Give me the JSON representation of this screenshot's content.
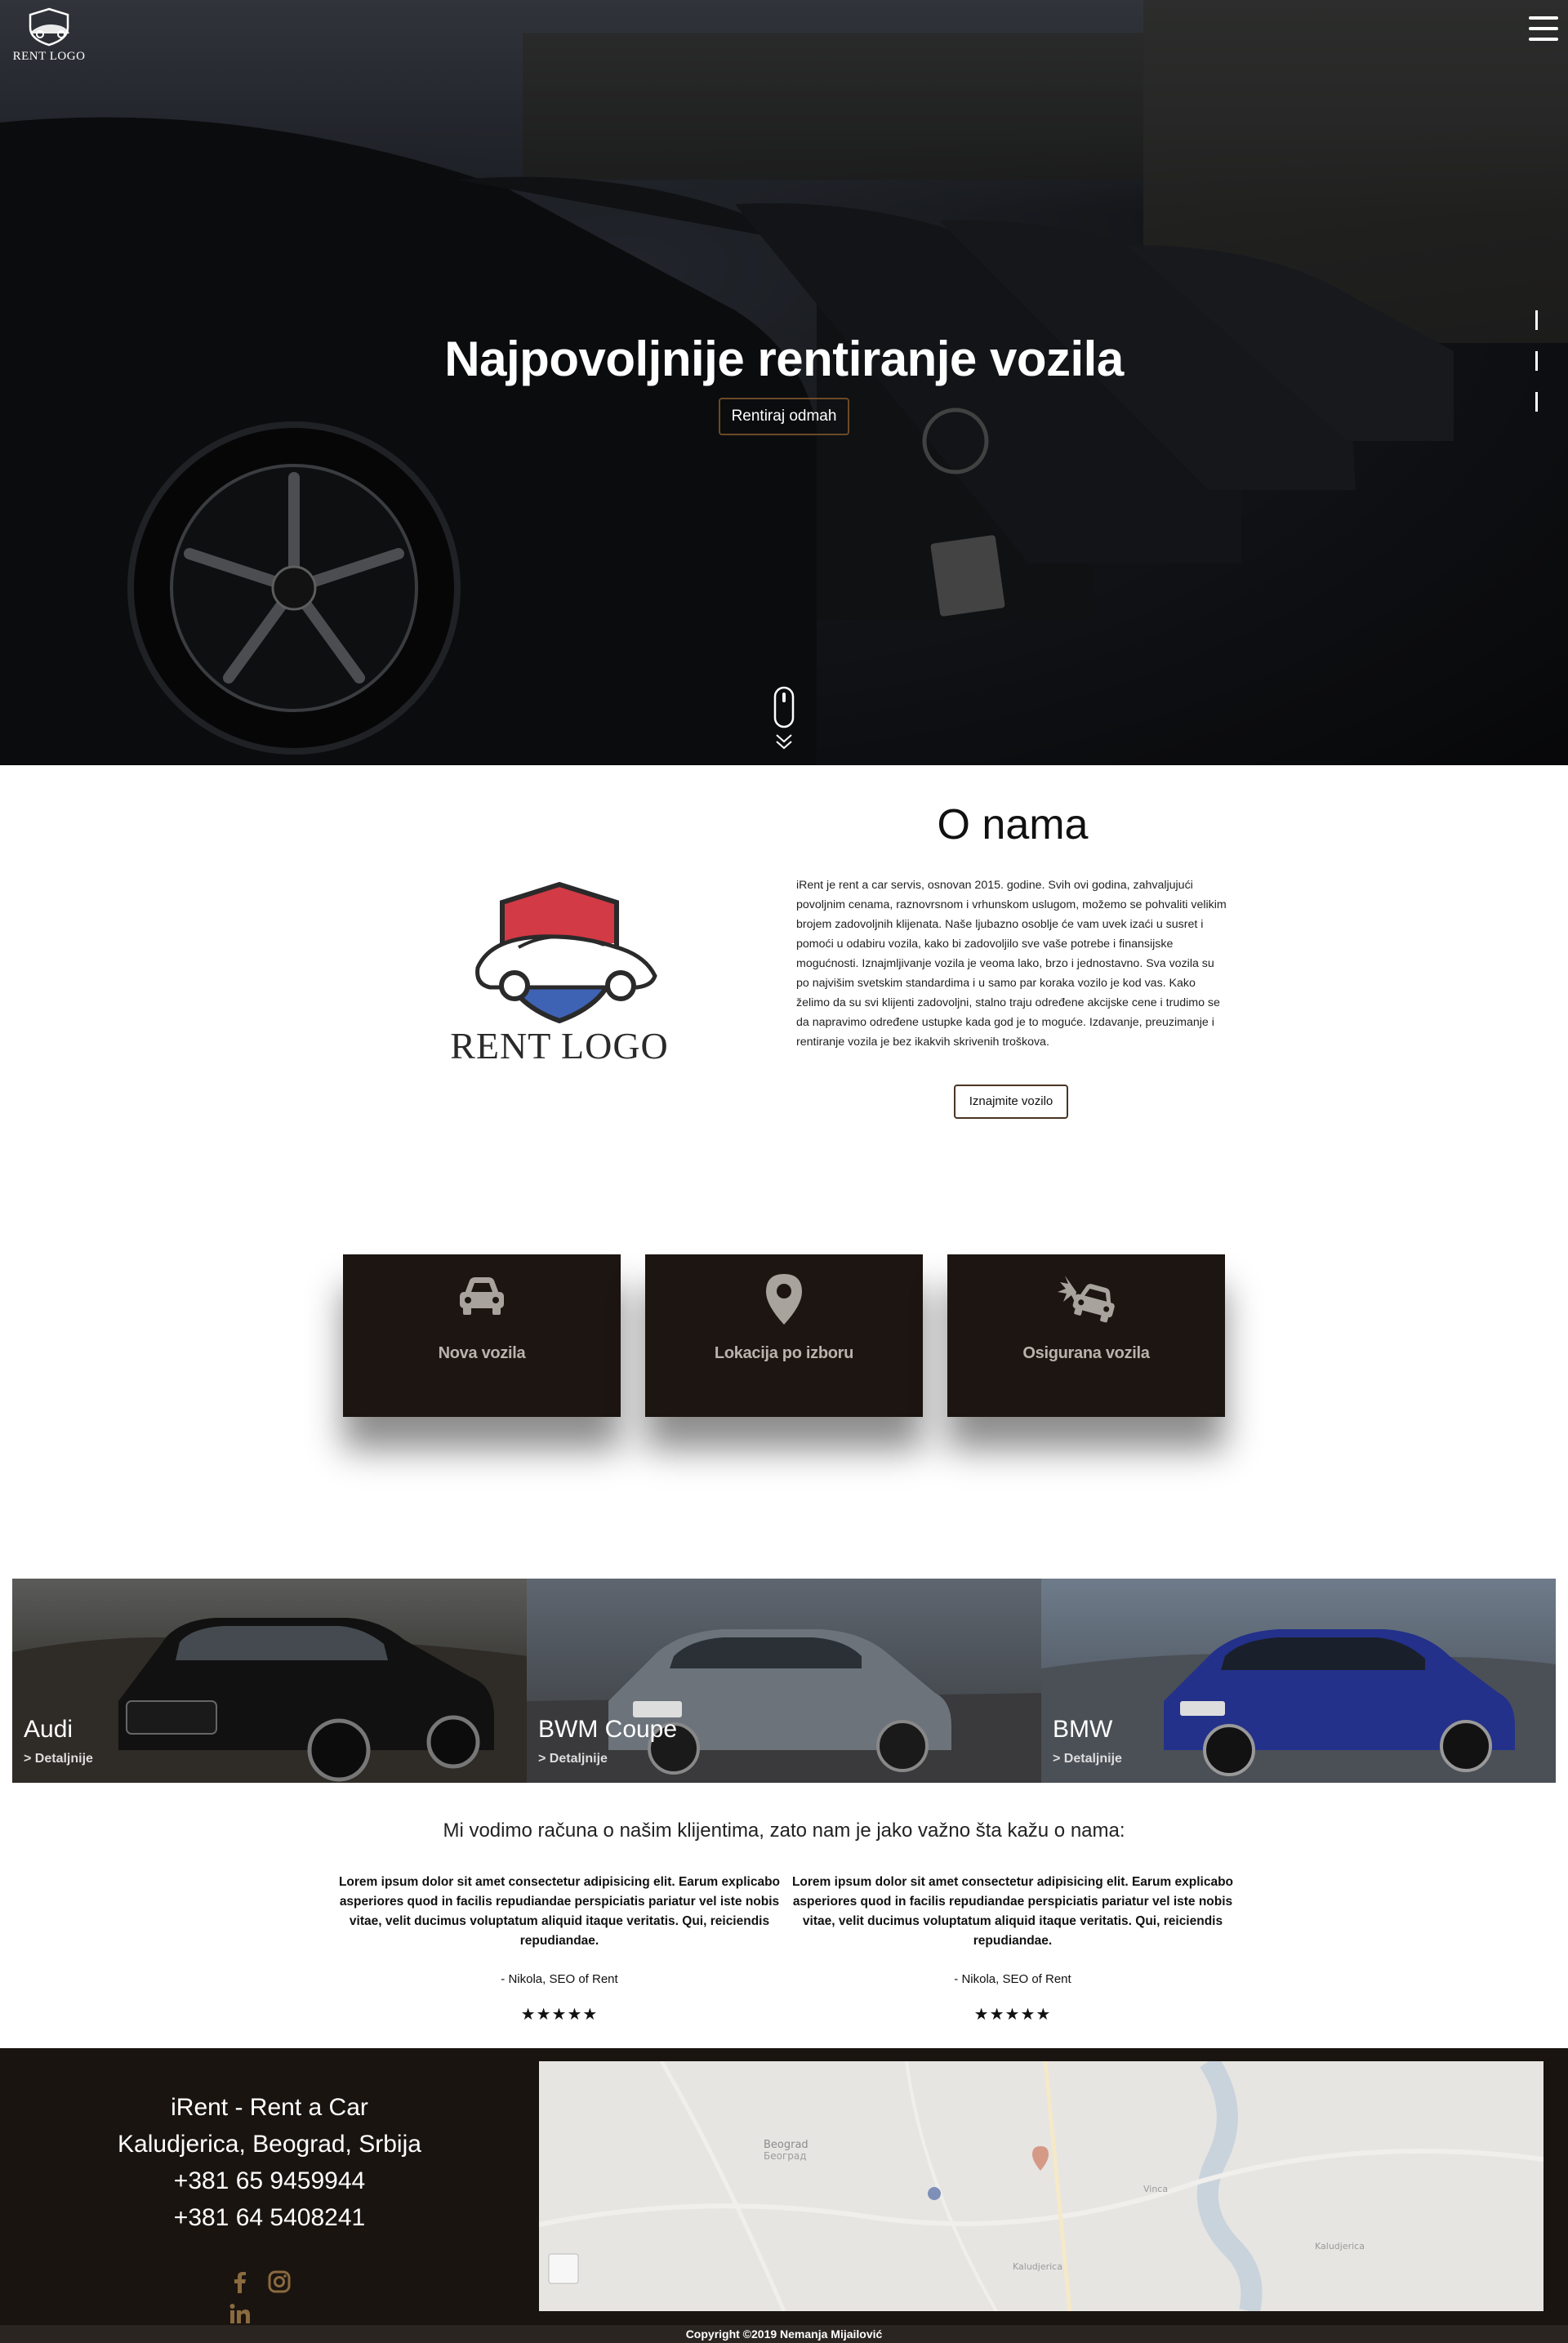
{
  "header": {
    "logo_text": "RENT LOGO",
    "menu_icon": "hamburger-icon"
  },
  "hero": {
    "title": "Najpovoljnije rentiranje vozila",
    "cta_label": "Rentiraj odmah",
    "scroll_icon": "mouse-scroll-icon"
  },
  "about": {
    "logo_text": "RENT LOGO",
    "title": "O nama",
    "text": "iRent je rent a car servis, osnovan 2015. godine. Svih ovi godina, zahvaljujući povoljnim cenama, raznovrsnom i vrhunskom uslugom, možemo se pohvaliti velikim brojem zadovoljnih klijenata. Naše ljubazno osoblje će vam uvek izaći u susret i pomoći u odabiru vozila, kako bi zadovoljilo sve vaše potrebe i finansijske mogućnosti. Iznajmljivanje vozila je veoma lako, brzo i jednostavno. Sva vozila su po najvišim svetskim standardima i u samo par koraka vozilo je kod vas. Kako želimo da su svi klijenti zadovoljni, stalno traju određene akcijske cene i trudimo se da napravimo određene ustupke kada god je to moguće. Izdavanje, preuzimanje i rentiranje vozila je bez ikakvih skrivenih troškova.",
    "button_label": "Iznajmite vozilo"
  },
  "features": [
    {
      "label": "Nova vozila",
      "icon": "car-icon"
    },
    {
      "label": "Lokacija po izboru",
      "icon": "map-marker-icon"
    },
    {
      "label": "Osigurana vozila",
      "icon": "car-crash-icon"
    }
  ],
  "cars": [
    {
      "name": "Audi",
      "details": "> Detaljnije"
    },
    {
      "name": "BWM Coupe",
      "details": "> Detaljnije"
    },
    {
      "name": "BMW",
      "details": "> Detaljnije"
    }
  ],
  "testimonials": {
    "title": "Mi vodimo računa o našim klijentima, zato nam je jako važno šta kažu o nama:",
    "items": [
      {
        "quote": "Lorem ipsum dolor sit amet consectetur adipisicing elit. Earum explicabo asperiores quod in facilis repudiandae perspiciatis pariatur vel iste nobis vitae, velit ducimus voluptatum aliquid itaque veritatis. Qui, reiciendis repudiandae.",
        "author": "- Nikola, SEO of Rent",
        "stars": "★★★★★",
        "rating": 5
      },
      {
        "quote": "Lorem ipsum dolor sit amet consectetur adipisicing elit. Earum explicabo asperiores quod in facilis repudiandae perspiciatis pariatur vel iste nobis vitae, velit ducimus voluptatum aliquid itaque veritatis. Qui, reiciendis repudiandae.",
        "author": "- Nikola, SEO of Rent",
        "stars": "★★★★★",
        "rating": 5
      }
    ]
  },
  "footer": {
    "company": "iRent - Rent a Car",
    "address": "Kaludjerica, Beograd, Srbija",
    "phone1": "+381 65 9459944",
    "phone2": "+381 64 5408241",
    "socials": [
      "facebook-icon",
      "instagram-icon",
      "linkedin-icon"
    ],
    "map_labels": {
      "city": "Beograd",
      "city_cyr": "Београд",
      "place1": "Kaludjerica",
      "place2": "Vinca",
      "place3": "Kaludjerica"
    },
    "copyright": "Copyright ©2019 Nemanja Mijailović"
  },
  "colors": {
    "accent": "#6b4a28",
    "dark": "#1c1511",
    "social": "#8a6a3f"
  }
}
